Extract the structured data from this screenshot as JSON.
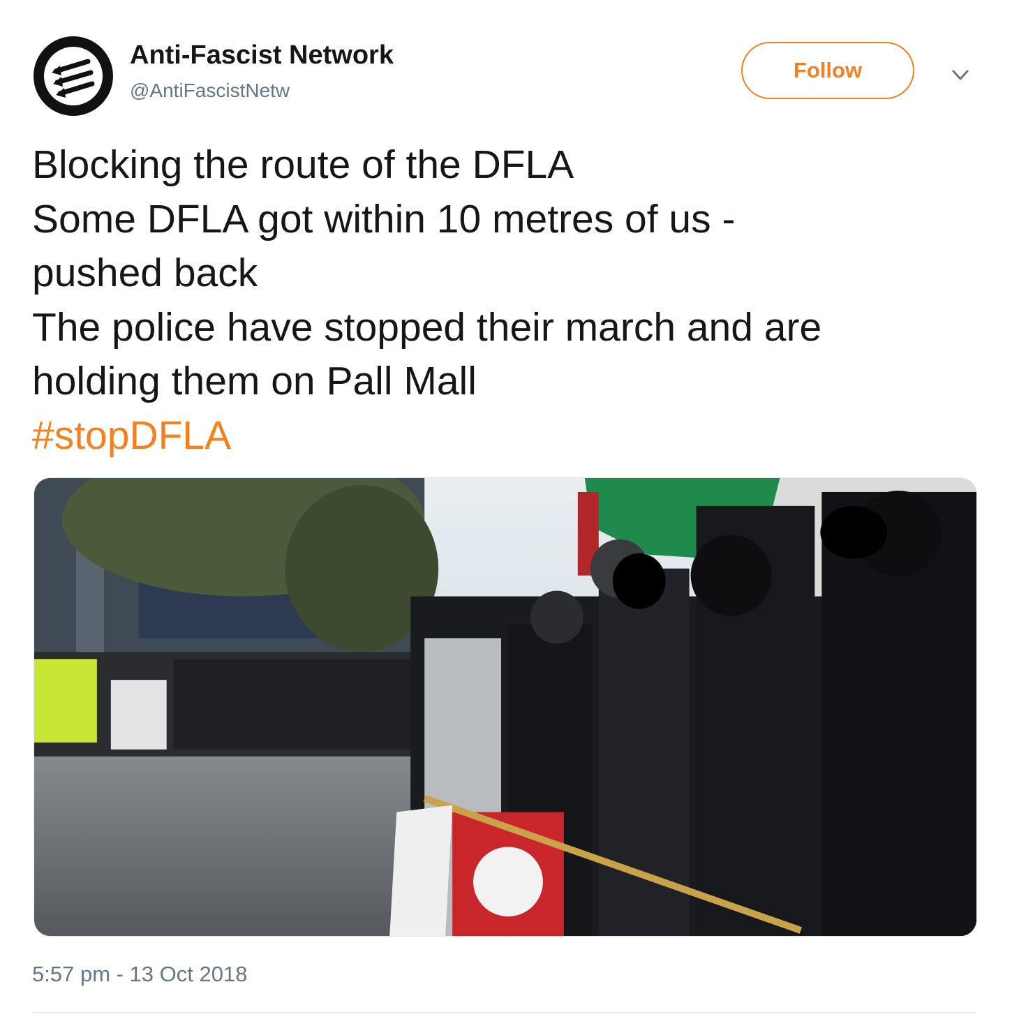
{
  "author": {
    "name": "Anti-Fascist Network",
    "handle": "@AntiFascistNetw",
    "avatar_icon": "anti-fascist-three-arrows-logo"
  },
  "follow_label": "Follow",
  "more_icon": "chevron-down-icon",
  "tweet": {
    "lines": [
      "Blocking the route of the DFLA",
      "Some DFLA got within 10 metres of us -",
      "pushed back",
      "The police have stopped their march and are",
      "holding them on Pall Mall"
    ],
    "hashtag": "#stopDFLA"
  },
  "media": {
    "kind": "photo",
    "subject": "protest-line-photo"
  },
  "timestamp": "5:57 pm - 13 Oct 2018",
  "colors": {
    "accent": "#f4801f",
    "text": "#14171a",
    "secondary": "#657786",
    "divider": "#e6ecf0"
  }
}
